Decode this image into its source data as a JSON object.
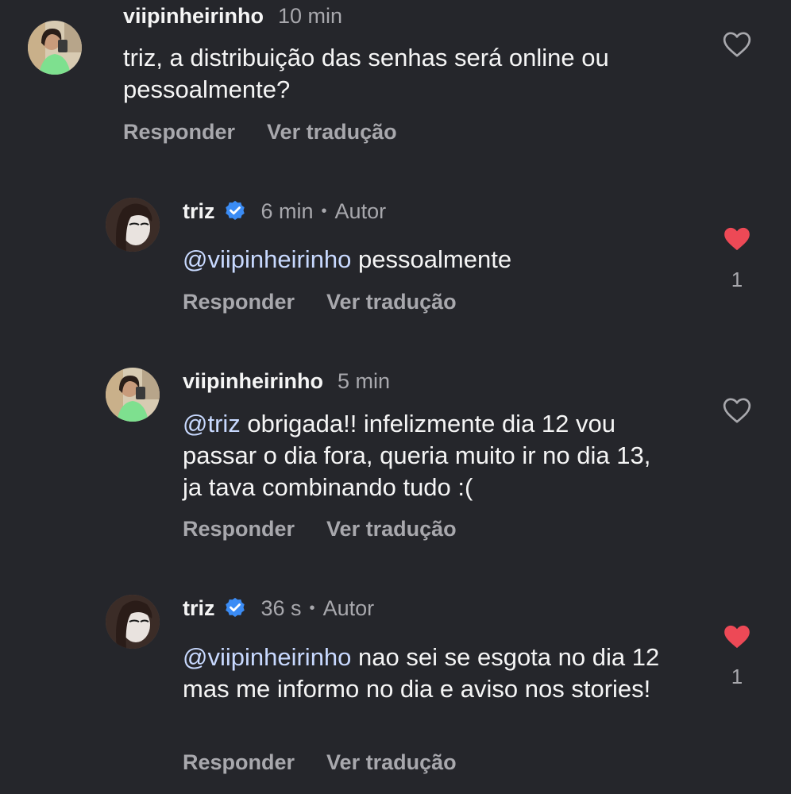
{
  "colors": {
    "background": "#25262b",
    "text": "#f5f5f5",
    "muted": "#a8a8ad",
    "mention": "#c8d9ff",
    "verified": "#3b8cf5",
    "like_active": "#ed4956"
  },
  "comments": [
    {
      "username": "viipinheirinho",
      "time": "10 min",
      "text": "triz, a distribuição das senhas será online ou pessoalmente?",
      "reply_label": "Responder",
      "translate_label": "Ver tradução",
      "liked": false,
      "like_icon": "heart-outline-icon"
    },
    {
      "username": "triz",
      "verified": true,
      "time": "6 min",
      "author_label": "Autor",
      "mention": "@viipinheirinho",
      "text": "pessoalmente",
      "reply_label": "Responder",
      "translate_label": "Ver tradução",
      "liked": true,
      "like_icon": "heart-filled-icon",
      "like_count": "1"
    },
    {
      "username": "viipinheirinho",
      "time": "5 min",
      "mention": "@triz",
      "text": "obrigada!! infelizmente dia 12 vou passar o dia fora, queria muito ir no dia 13, ja tava combinando tudo :(",
      "reply_label": "Responder",
      "translate_label": "Ver tradução",
      "liked": false,
      "like_icon": "heart-outline-icon"
    },
    {
      "username": "triz",
      "verified": true,
      "time": "36 s",
      "author_label": "Autor",
      "mention": "@viipinheirinho",
      "text": "nao sei se esgota no dia 12 mas me informo no dia e aviso nos stories!",
      "reply_label": "Responder",
      "translate_label": "Ver tradução",
      "liked": true,
      "like_icon": "heart-filled-icon",
      "like_count": "1"
    }
  ]
}
